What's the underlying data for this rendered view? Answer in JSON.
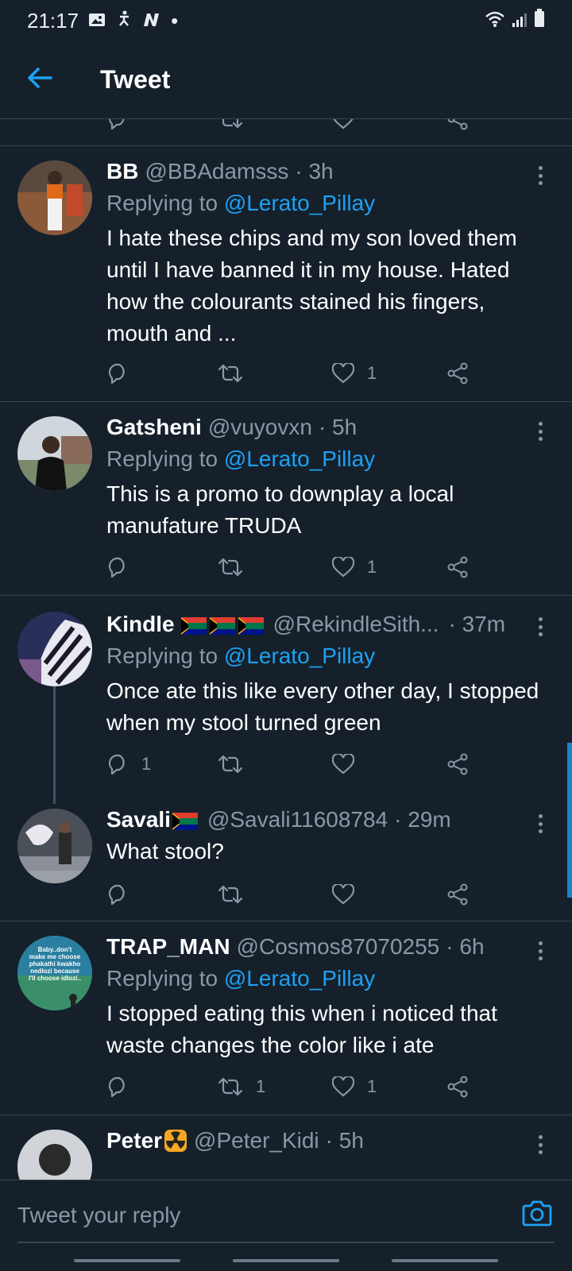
{
  "status_bar": {
    "time": "21:17",
    "dot": "•"
  },
  "header": {
    "title": "Tweet"
  },
  "tweets": [
    {
      "name": "BB",
      "handle": "@BBAdamsss",
      "time": "· 3h",
      "replying_prefix": "Replying to ",
      "mention": "@Lerato_Pillay",
      "text": "I hate these chips and my son loved them until I have banned it in my house. Hated how the colourants stained his fingers, mouth and ...",
      "reply_count": "",
      "retweet_count": "",
      "like_count": "1"
    },
    {
      "name": "Gatsheni",
      "handle": "@vuyovxn",
      "time": "· 5h",
      "replying_prefix": "Replying to ",
      "mention": "@Lerato_Pillay",
      "text": "This is a promo to downplay a local manufature TRUDA",
      "reply_count": "",
      "retweet_count": "",
      "like_count": "1"
    },
    {
      "name": "Kindle",
      "handle": "@RekindleSith...",
      "time": "· 37m",
      "replying_prefix": "Replying to ",
      "mention": "@Lerato_Pillay",
      "text": "Once ate this like every other day, I stopped when my stool turned green",
      "reply_count": "1",
      "retweet_count": "",
      "like_count": ""
    },
    {
      "name": "Savali",
      "handle": "@Savali11608784",
      "time": "· 29m",
      "text": "What stool?",
      "reply_count": "",
      "retweet_count": "",
      "like_count": ""
    },
    {
      "name": "TRAP_MAN",
      "handle": "@Cosmos87070255",
      "time": "· 6h",
      "replying_prefix": "Replying to ",
      "mention": "@Lerato_Pillay",
      "text": "I stopped eating this when i noticed that waste changes the color like i ate",
      "reply_count": "",
      "retweet_count": "1",
      "like_count": "1",
      "avatar_text": [
        "Baby..don't",
        "make me choose",
        "phakathi kwakho",
        "nedlozi because",
        "I'll choose idlozi.."
      ]
    },
    {
      "name": "Peter",
      "handle": "@Peter_Kidi",
      "time": "· 5h"
    }
  ],
  "reply_bar": {
    "placeholder": "Tweet your reply"
  },
  "colors": {
    "background": "#15202b",
    "accent": "#1da1f2",
    "muted": "#8899a6",
    "divider": "#38444d"
  },
  "icons": [
    "back-arrow-icon",
    "reply-icon",
    "retweet-icon",
    "like-icon",
    "share-icon",
    "more-icon",
    "camera-icon",
    "south-africa-flag-icon",
    "radioactive-emoji-icon"
  ]
}
